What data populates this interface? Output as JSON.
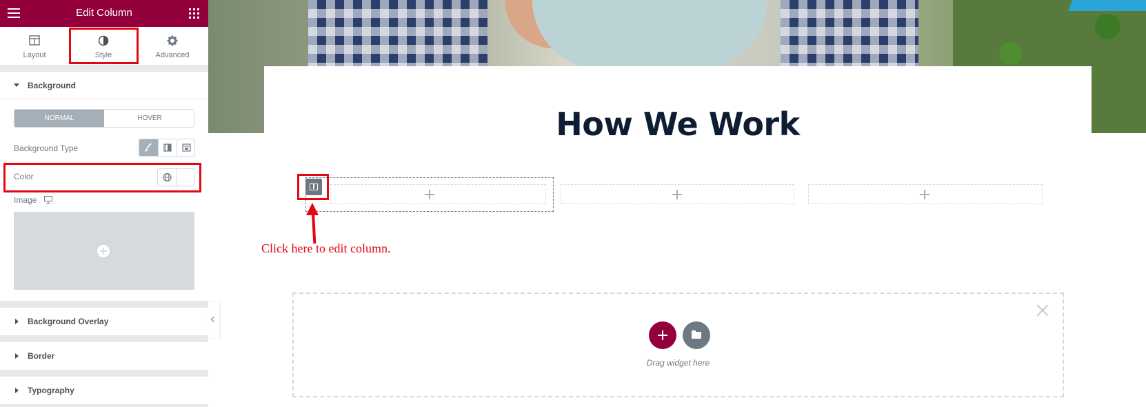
{
  "panel": {
    "title": "Edit Column",
    "tabs": [
      {
        "label": "Layout",
        "icon": "layout-icon"
      },
      {
        "label": "Style",
        "icon": "style-icon"
      },
      {
        "label": "Advanced",
        "icon": "gear-icon"
      }
    ],
    "background_section": {
      "title": "Background",
      "state_tabs": [
        "NORMAL",
        "HOVER"
      ],
      "background_type_label": "Background Type",
      "color_label": "Color",
      "image_label": "Image"
    },
    "collapsed_sections": [
      "Background Overlay",
      "Border",
      "Typography"
    ]
  },
  "canvas": {
    "heading": "How We Work",
    "hint_text": "Click here to edit column.",
    "dropzone_text": "Drag widget here"
  },
  "colors": {
    "accent": "#93003c",
    "annotation_red": "#e30613",
    "heading": "#0f1d33",
    "muted": "#6d7882"
  }
}
